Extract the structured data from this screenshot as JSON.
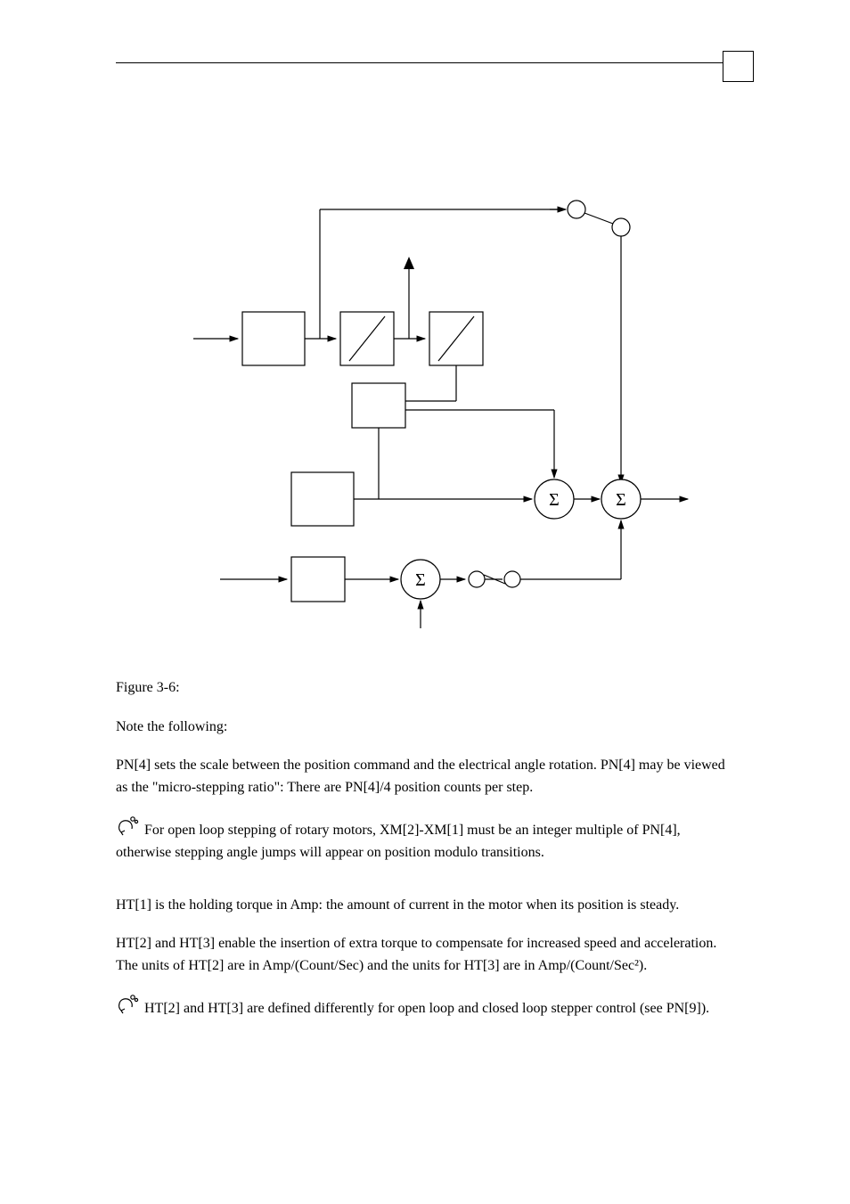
{
  "figure": {
    "caption": "Figure 3-6:",
    "sigma1": "Σ",
    "sigma2": "Σ",
    "sigma3": "Σ"
  },
  "text": {
    "note_following": "Note the following:",
    "p1": "PN[4] sets the scale between the position command and the electrical angle rotation. PN[4] may be viewed as the \"micro-stepping ratio\": There are PN[4]/4 position counts per step.",
    "note1": "For open loop stepping of rotary motors, XM[2]-XM[1]  must be an integer multiple of PN[4], otherwise stepping angle jumps will appear on position modulo transitions.",
    "p2": "HT[1] is the holding torque in Amp: the amount of current in the motor when its position is steady.",
    "p3": "HT[2] and HT[3] enable the insertion of extra torque to compensate for increased speed and acceleration. The units of HT[2] are in Amp/(Count/Sec) and the units for HT[3] are in Amp/(Count/Sec²).",
    "note2": " HT[2] and HT[3] are defined differently for open loop and closed loop stepper control (see PN[9])."
  }
}
